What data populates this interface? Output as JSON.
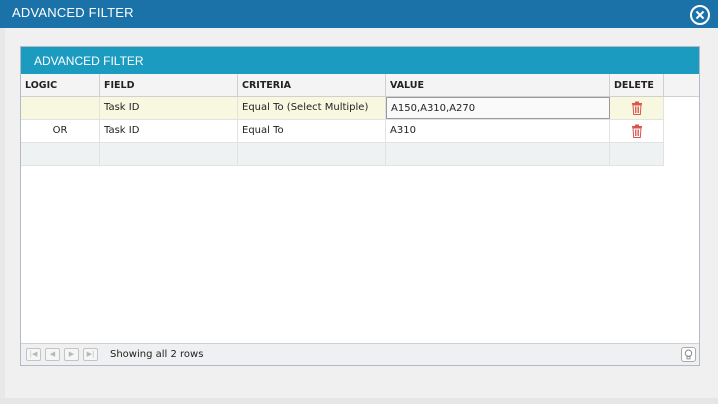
{
  "window": {
    "title": "ADVANCED FILTER"
  },
  "panel": {
    "title": "ADVANCED FILTER"
  },
  "grid": {
    "columns": [
      "LOGIC",
      "FIELD",
      "CRITERIA",
      "VALUE",
      "DELETE"
    ],
    "rows": [
      {
        "logic": "",
        "field": "Task ID",
        "criteria": "Equal To (Select Multiple)",
        "value": "A150,A310,A270"
      },
      {
        "logic": "OR",
        "field": "Task ID",
        "criteria": "Equal To",
        "value": "A310"
      }
    ]
  },
  "footer": {
    "info": "Showing all 2 rows"
  },
  "icons": {
    "close": "close-icon",
    "delete": "trash-icon",
    "hint": "lightbulb-icon"
  },
  "colors": {
    "titlebar": "#1a72a8",
    "panel_header": "#1b9bbf",
    "selected_row": "#f8f7e0",
    "trash": "#d9534f"
  }
}
